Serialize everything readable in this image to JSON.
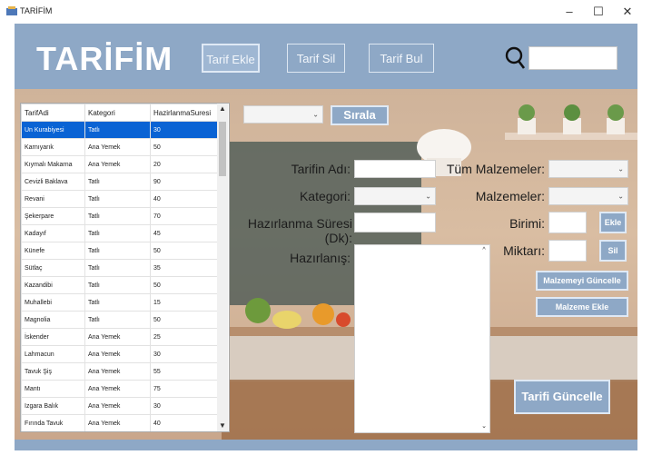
{
  "window": {
    "title": "TARİFİM",
    "minimize": "–",
    "maximize": "☐",
    "close": "✕"
  },
  "header": {
    "logo": "TARİFİM",
    "buttons": {
      "add": "Tarif Ekle",
      "delete": "Tarif Sil",
      "find": "Tarif Bul"
    },
    "search_placeholder": ""
  },
  "grid": {
    "columns": [
      "TarifAdi",
      "Kategori",
      "HazirlanmaSuresi"
    ],
    "rows": [
      [
        "Un Kurabiyesi",
        "Tatlı",
        "30"
      ],
      [
        "Karnıyarık",
        "Ana Yemek",
        "50"
      ],
      [
        "Kıymalı Makarna",
        "Ana Yemek",
        "20"
      ],
      [
        "Cevizli Baklava",
        "Tatlı",
        "90"
      ],
      [
        "Revani",
        "Tatlı",
        "40"
      ],
      [
        "Şekerpare",
        "Tatlı",
        "70"
      ],
      [
        "Kadayıf",
        "Tatlı",
        "45"
      ],
      [
        "Künefe",
        "Tatlı",
        "50"
      ],
      [
        "Sütlaç",
        "Tatlı",
        "35"
      ],
      [
        "Kazandibi",
        "Tatlı",
        "50"
      ],
      [
        "Muhallebi",
        "Tatlı",
        "15"
      ],
      [
        "Magnolia",
        "Tatlı",
        "50"
      ],
      [
        "İskender",
        "Ana Yemek",
        "25"
      ],
      [
        "Lahmacun",
        "Ana Yemek",
        "30"
      ],
      [
        "Tavuk Şiş",
        "Ana Yemek",
        "55"
      ],
      [
        "Mantı",
        "Ana Yemek",
        "75"
      ],
      [
        "Izgara Balık",
        "Ana Yemek",
        "30"
      ],
      [
        "Fırında Tavuk",
        "Ana Yemek",
        "40"
      ]
    ],
    "selected_row": 0
  },
  "sort": {
    "selected": "",
    "button": "Sırala"
  },
  "form": {
    "name_label": "Tarifin Adı:",
    "category_label": "Kategori:",
    "time_label": "Hazırlanma Süresi (Dk):",
    "instructions_label": "Hazırlanış:",
    "all_ingredients_label": "Tüm Malzemeler:",
    "ingredients_label": "Malzemeler:",
    "unit_label": "Birimi:",
    "amount_label": "Miktarı:",
    "add_small": "Ekle",
    "delete_small": "Sil",
    "update_ingredient": "Malzemeyi Güncelle",
    "add_ingredient": "Malzeme Ekle",
    "update_recipe": "Tarifi Güncelle"
  }
}
